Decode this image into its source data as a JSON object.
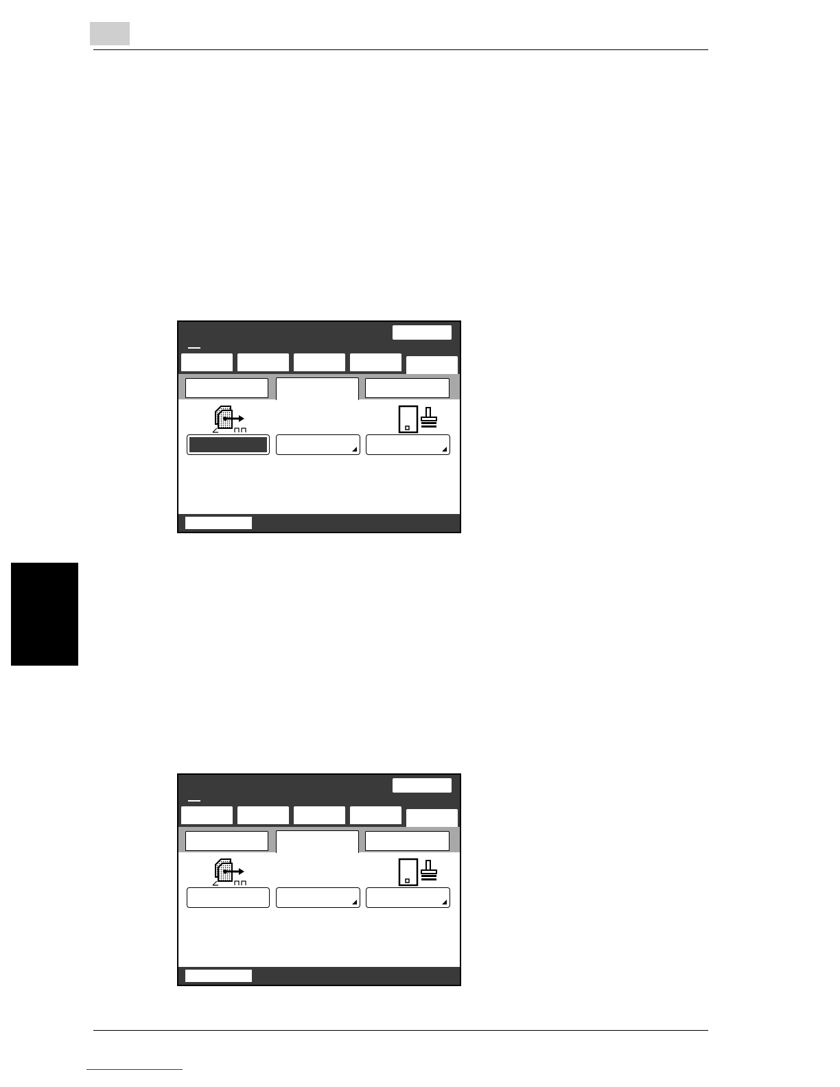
{
  "page": {
    "chapter_tab_color": "#000000",
    "page_number_box_color": "#cfcfcf",
    "footer_link_color": "#2a2ad0"
  },
  "screens": [
    {
      "name": "screen-1",
      "header_color": "#3a3a3a",
      "main_tabs_count": 5,
      "active_main_tab_index": 4,
      "sub_tabs_count": 3,
      "active_sub_tab_index": 1,
      "selected_function_button_index": 0,
      "icons": [
        "image-shift-icon",
        "stamp-icon"
      ]
    },
    {
      "name": "screen-2",
      "header_color": "#3a3a3a",
      "main_tabs_count": 5,
      "active_main_tab_index": 4,
      "sub_tabs_count": 3,
      "active_sub_tab_index": 1,
      "selected_function_button_index": null,
      "icons": [
        "image-shift-icon",
        "stamp-icon"
      ]
    }
  ]
}
